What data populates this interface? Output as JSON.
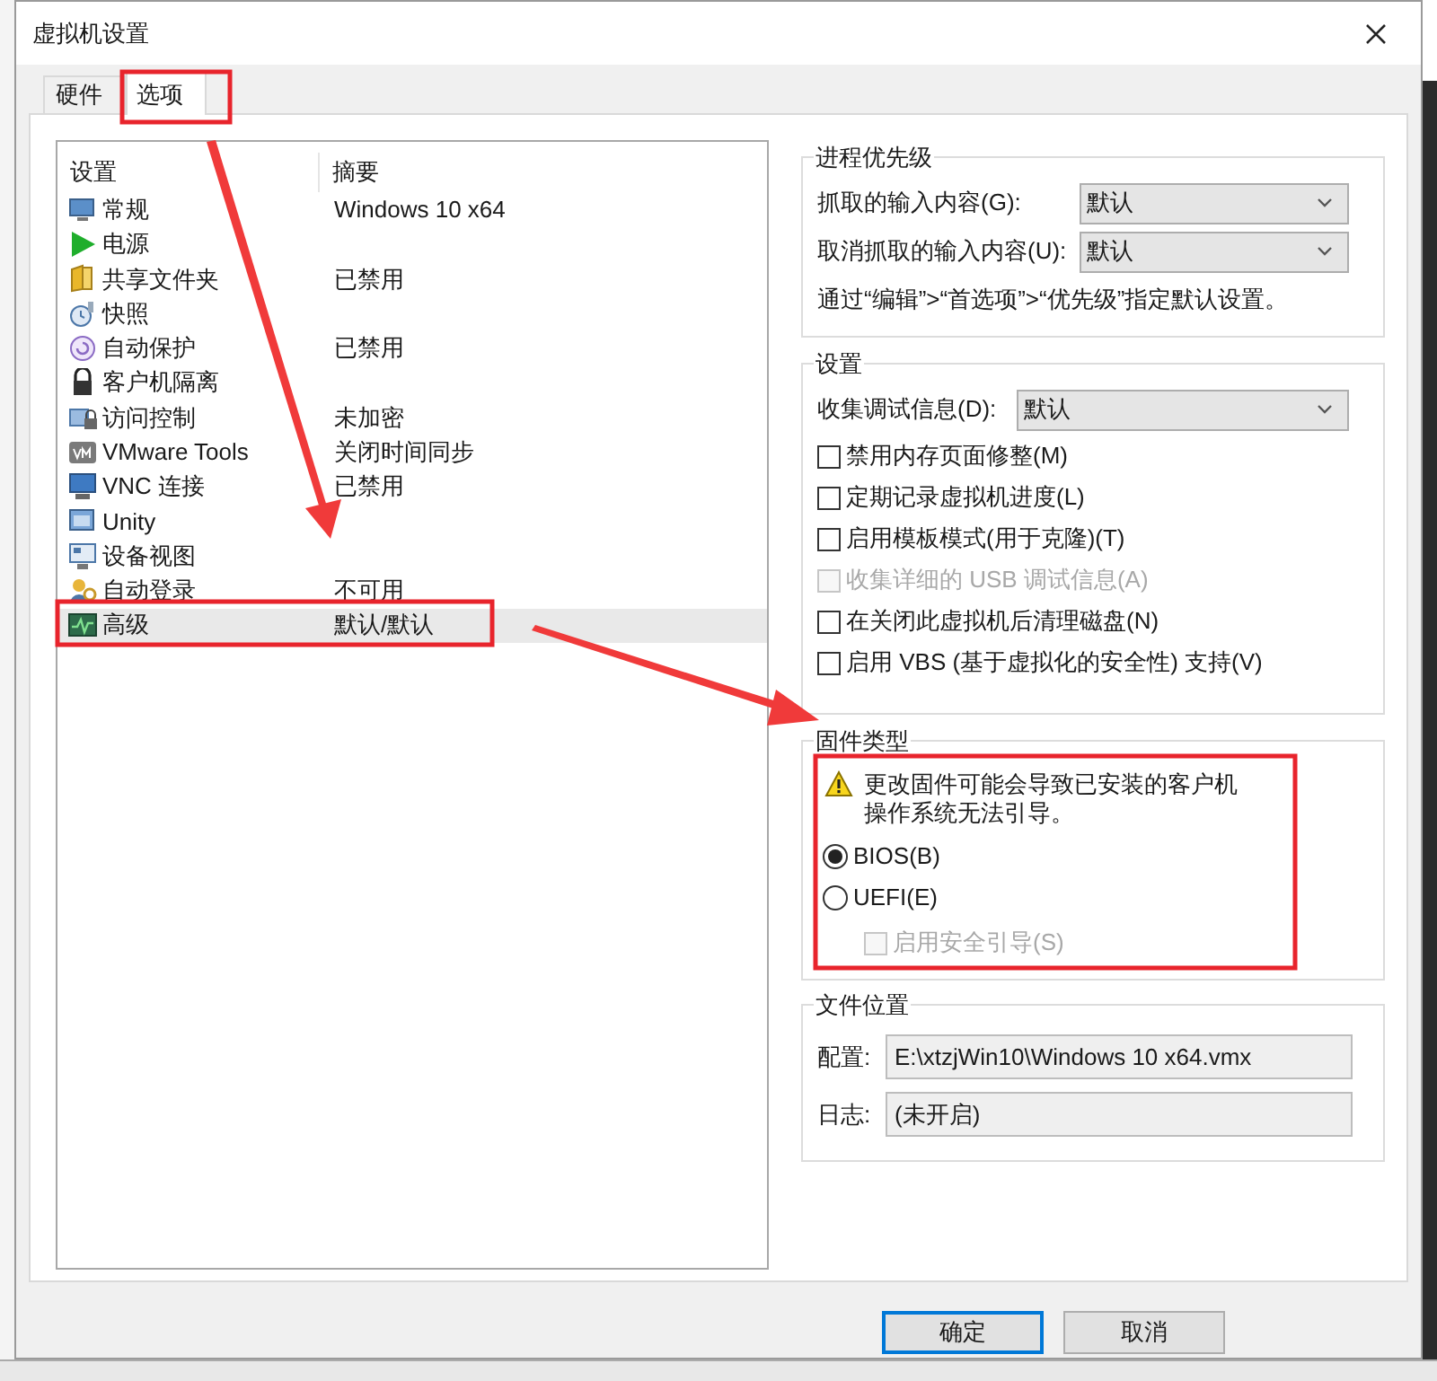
{
  "window": {
    "title": "虚拟机设置"
  },
  "tabs": [
    {
      "label": "硬件",
      "selected": false
    },
    {
      "label": "选项",
      "selected": true
    }
  ],
  "settings_list": {
    "columns": [
      "设置",
      "摘要"
    ],
    "rows": [
      {
        "name": "常规",
        "summary": "Windows 10 x64",
        "selected": false
      },
      {
        "name": "电源",
        "selected": false
      },
      {
        "name": "共享文件夹",
        "summary": "已禁用",
        "selected": false
      },
      {
        "name": "快照",
        "selected": false
      },
      {
        "name": "自动保护",
        "summary": "已禁用",
        "selected": false
      },
      {
        "name": "客户机隔离",
        "selected": false
      },
      {
        "name": "访问控制",
        "summary": "未加密",
        "selected": false
      },
      {
        "name": "VMware Tools",
        "summary": "关闭时间同步",
        "selected": false
      },
      {
        "name": "VNC 连接",
        "summary": "已禁用",
        "selected": false
      },
      {
        "name": "Unity",
        "selected": false
      },
      {
        "name": "设备视图",
        "selected": false
      },
      {
        "name": "自动登录",
        "summary": "不可用",
        "selected": false
      },
      {
        "name": "高级",
        "summary": "默认/默认",
        "selected": true
      }
    ]
  },
  "process_priority": {
    "title": "进程优先级",
    "fields": [
      {
        "label": "抓取的输入内容(G):",
        "value": "默认"
      },
      {
        "label": "取消抓取的输入内容(U):",
        "value": "默认"
      }
    ],
    "note": "通过“编辑”>“首选项”>“优先级”指定默认设置。"
  },
  "settings": {
    "title": "设置",
    "debug": {
      "label": "收集调试信息(D):",
      "value": "默认"
    },
    "options": [
      {
        "label": "禁用内存页面修整(M)",
        "checked": false,
        "disabled": false
      },
      {
        "label": "定期记录虚拟机进度(L)",
        "checked": false,
        "disabled": false
      },
      {
        "label": "启用模板模式(用于克隆)(T)",
        "checked": false,
        "disabled": false
      },
      {
        "label": "收集详细的 USB 调试信息(A)",
        "checked": false,
        "disabled": true
      },
      {
        "label": "在关闭此虚拟机后清理磁盘(N)",
        "checked": false,
        "disabled": false
      },
      {
        "label": "启用 VBS (基于虚拟化的安全性) 支持(V)",
        "checked": false,
        "disabled": false
      }
    ]
  },
  "firmware": {
    "title": "固件类型",
    "warning": [
      "更改固件可能会导致已安装的客户机",
      "操作系统无法引导。"
    ],
    "options": [
      {
        "label": "BIOS(B)",
        "selected": true
      },
      {
        "label": "UEFI(E)",
        "selected": false
      }
    ],
    "secure_boot": {
      "label": "启用安全引导(S)",
      "checked": false,
      "disabled": true
    }
  },
  "file_location": {
    "title": "文件位置",
    "fields": [
      {
        "label": "配置:",
        "value": "E:\\xtzjWin10\\Windows 10 x64.vmx"
      },
      {
        "label": "日志:",
        "value": "(未开启)"
      }
    ]
  },
  "buttons": [
    {
      "label": "确定",
      "default": true
    },
    {
      "label": "取消",
      "default": false
    }
  ]
}
